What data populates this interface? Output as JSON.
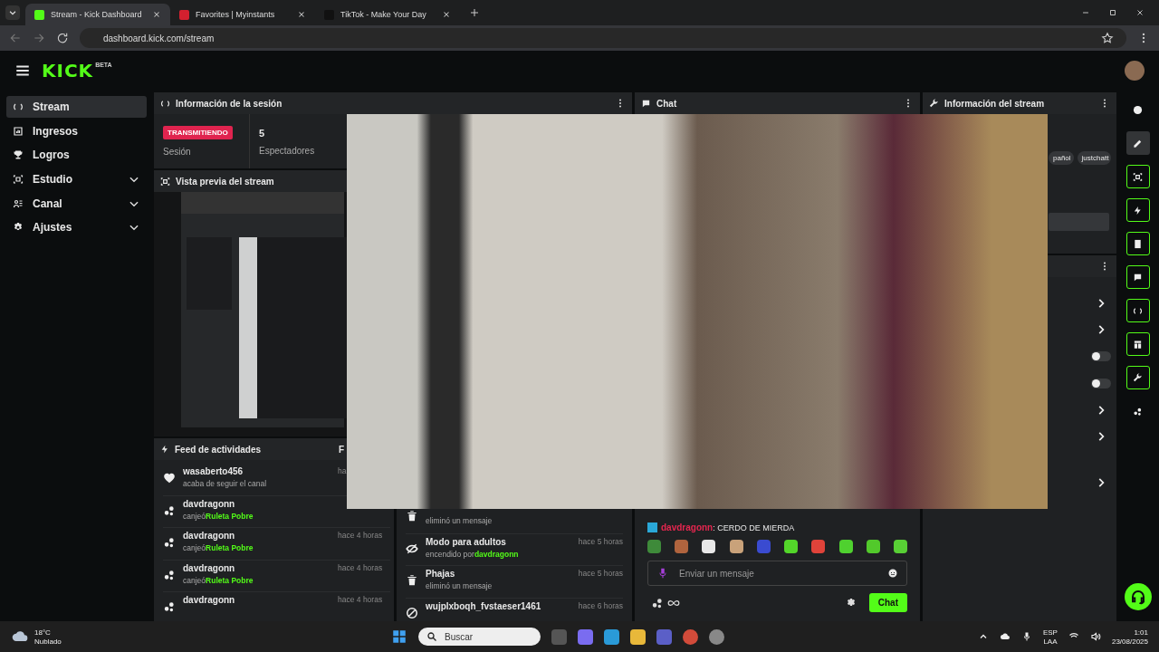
{
  "browser": {
    "tabs": [
      {
        "title": "Stream - Kick Dashboard",
        "kind": "kick",
        "selected": true
      },
      {
        "title": "Favorites | Myinstants",
        "kind": "myinstants",
        "selected": false
      },
      {
        "title": "TikTok - Make Your Day",
        "kind": "tiktok",
        "selected": false
      }
    ],
    "url": "dashboard.kick.com/stream"
  },
  "header": {
    "logo": "KICK",
    "badge": "BETA"
  },
  "sidebar": {
    "items": [
      {
        "label": "Stream",
        "kind": "stream",
        "selected": true,
        "expandable": false
      },
      {
        "label": "Ingresos",
        "kind": "revenue",
        "selected": false,
        "expandable": false
      },
      {
        "label": "Logros",
        "kind": "trophy",
        "selected": false,
        "expandable": false
      },
      {
        "label": "Estudio",
        "kind": "studio",
        "selected": false,
        "expandable": true
      },
      {
        "label": "Canal",
        "kind": "channel",
        "selected": false,
        "expandable": true
      },
      {
        "label": "Ajustes",
        "kind": "settings",
        "selected": false,
        "expandable": true
      }
    ]
  },
  "session_panel": {
    "title": "Información de la sesión",
    "status": "TRANSMITIENDO",
    "status_label": "Sesión",
    "viewers": "5",
    "viewers_label": "Espectadores"
  },
  "preview_panel": {
    "title": "Vista previa del stream"
  },
  "activity_feed": {
    "title": "Feed de actividades",
    "tab": "F",
    "items": [
      {
        "kind": "follow",
        "user": "wasaberto456",
        "action": "acaba de seguir el canal",
        "time": "ha"
      },
      {
        "kind": "redeem",
        "user": "davdragonn",
        "action": "canjeó",
        "reward": "Ruleta Pobre"
      },
      {
        "kind": "redeem",
        "user": "davdragonn",
        "action": "canjeó",
        "reward": "Ruleta Pobre",
        "time": "hace 4 horas"
      },
      {
        "kind": "redeem",
        "user": "davdragonn",
        "action": "canjeó",
        "reward": "Ruleta Pobre",
        "time": "hace 4 horas"
      },
      {
        "kind": "redeem",
        "user": "davdragonn",
        "time": "hace 4 horas"
      }
    ]
  },
  "mod_feed": {
    "items": [
      {
        "kind": "delete",
        "action": "eliminó un mensaje"
      },
      {
        "kind": "adult",
        "title": "Modo para adultos",
        "action": "encendido por",
        "actor": "davdragonn",
        "time": "hace 5 horas"
      },
      {
        "kind": "delete",
        "title": "Phajas",
        "action": "eliminó un mensaje",
        "time": "hace 5 horas"
      },
      {
        "kind": "ban",
        "title": "wujplxboqh_fvstaeser1461",
        "time": "hace 6 horas"
      }
    ]
  },
  "chat": {
    "title": "Chat",
    "messages": [
      {
        "user": "davdragonn",
        "text": ": CERDO DE MIERDA",
        "color": "#e5264f"
      }
    ],
    "placeholder": "Enviar un mensaje",
    "send_label": "Chat"
  },
  "stream_info": {
    "title": "Información del stream",
    "tags": [
      "pañol",
      "justchatt"
    ],
    "rows": [
      {
        "kind": "link"
      },
      {
        "kind": "link"
      },
      {
        "kind": "toggle",
        "on": false
      },
      {
        "kind": "toggle",
        "on": false
      },
      {
        "kind": "link"
      },
      {
        "kind": "link"
      },
      {
        "kind": "link"
      }
    ]
  },
  "rail": {
    "items": [
      {
        "kind": "info",
        "selected": false,
        "highlighted": false
      },
      {
        "kind": "pencil",
        "selected": true,
        "highlighted": false
      },
      {
        "kind": "studio",
        "selected": false,
        "highlighted": true
      },
      {
        "kind": "bolt",
        "selected": false,
        "highlighted": true
      },
      {
        "kind": "doc",
        "selected": false,
        "highlighted": true
      },
      {
        "kind": "chat",
        "selected": false,
        "highlighted": true
      },
      {
        "kind": "stream",
        "selected": false,
        "highlighted": true
      },
      {
        "kind": "layout",
        "selected": false,
        "highlighted": true
      },
      {
        "kind": "wrench",
        "selected": false,
        "highlighted": true
      },
      {
        "kind": "points",
        "selected": false,
        "highlighted": false
      }
    ]
  },
  "taskbar": {
    "temperature": "18°C",
    "weather": "Nublado",
    "search_placeholder": "Buscar",
    "language": "ESP",
    "layout": "LAA",
    "time": "1:01",
    "date": "23/08/2025"
  }
}
